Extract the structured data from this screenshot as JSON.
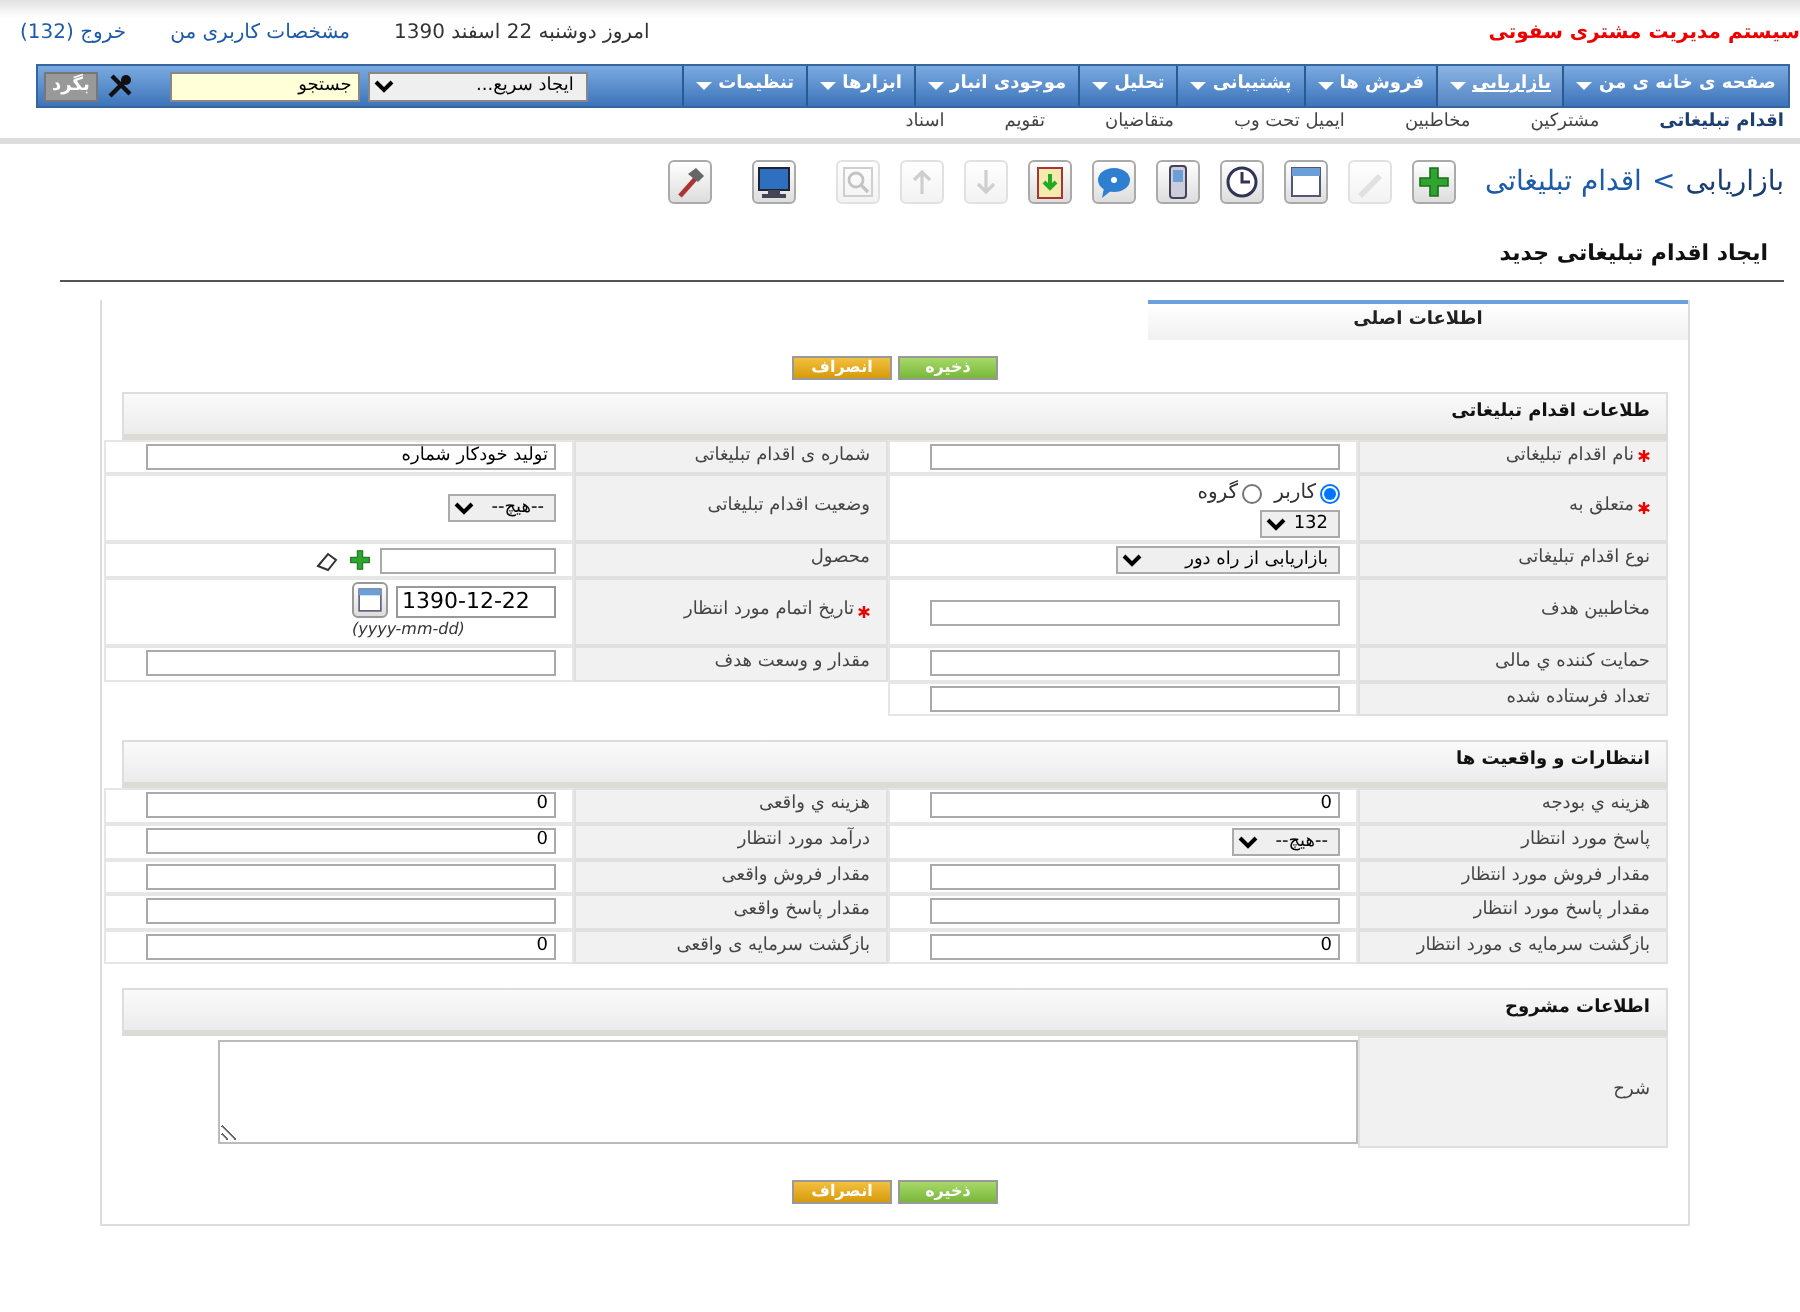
{
  "header": {
    "title": "سیستم مدیریت مشتری سفوتی",
    "date": "امروز دوشنبه 22 اسفند 1390",
    "links": [
      "مشخصات کاربری من",
      "خروج (132)"
    ]
  },
  "menu": [
    {
      "label": "صفحه ی خانه ی من",
      "selected": false
    },
    {
      "label": "بازاریابی",
      "selected": true
    },
    {
      "label": "فروش ها",
      "selected": false
    },
    {
      "label": "پشتیبانی",
      "selected": false
    },
    {
      "label": "تحلیل",
      "selected": false
    },
    {
      "label": "موجودی انبار",
      "selected": false
    },
    {
      "label": "ابزارها",
      "selected": false
    },
    {
      "label": "تنظیمات",
      "selected": false
    }
  ],
  "quick_create": {
    "value": "ایجاد سریع..."
  },
  "search": {
    "value": "جستجو",
    "button": "بگرد"
  },
  "submenu": [
    {
      "label": "اقدام تبلیغاتی",
      "selected": true
    },
    {
      "label": "مشترکین",
      "selected": false
    },
    {
      "label": "مخاطبین",
      "selected": false
    },
    {
      "label": "ایمیل تحت وب",
      "selected": false
    },
    {
      "label": "متقاضیان",
      "selected": false
    },
    {
      "label": "تقویم",
      "selected": false
    },
    {
      "label": "اسناد",
      "selected": false
    }
  ],
  "breadcrumb": [
    "بازاریابی",
    ">",
    "اقدام تبلیغاتی"
  ],
  "toolbar": [
    [
      {
        "kind": "add",
        "disabled": false
      },
      {
        "kind": "edit",
        "disabled": true
      },
      {
        "kind": "calendar",
        "disabled": false
      },
      {
        "kind": "clock",
        "disabled": false
      },
      {
        "kind": "mobile",
        "disabled": false
      },
      {
        "kind": "chat",
        "disabled": false
      },
      {
        "kind": "import",
        "disabled": false
      },
      {
        "kind": "down",
        "disabled": true
      },
      {
        "kind": "up",
        "disabled": true
      },
      {
        "kind": "find",
        "disabled": true
      }
    ],
    [
      {
        "kind": "monitor",
        "disabled": false
      }
    ],
    [
      {
        "kind": "hammer",
        "disabled": false
      }
    ]
  ],
  "page_title": "ایجاد اقدام تبلیغاتی جدید",
  "tabs": [
    {
      "label": "اطلاعات اصلی",
      "selected": true
    }
  ],
  "buttons": [
    {
      "kind": "save",
      "label": "ذخیره"
    },
    {
      "kind": "cancel",
      "label": "انصراف"
    }
  ],
  "sections": [
    {
      "title": "طلاعات اقدام تبلیغاتی",
      "rows": [
        [
          {
            "label": "نام اقدام تبلیغاتی",
            "required": true,
            "kind": "text"
          },
          {
            "label": "شماره ی اقدام تبلیغاتی",
            "required": false,
            "kind": "text",
            "value": "تولید خودکار شماره"
          }
        ],
        [
          {
            "label": "متعلق به",
            "required": true,
            "kind": "assign",
            "options": [
              {
                "label": "کاربر",
                "selected": true
              },
              {
                "label": "گروه",
                "selected": false
              }
            ],
            "value": "132"
          },
          {
            "label": "وضعیت اقدام تبلیغاتی",
            "required": false,
            "kind": "select",
            "value": "--هیچ--"
          }
        ],
        [
          {
            "label": "نوع اقدام تبلیغاتی",
            "required": false,
            "kind": "select",
            "value": "بازاریابی از راه دور"
          },
          {
            "label": "محصول",
            "required": false,
            "kind": "product"
          }
        ],
        [
          {
            "label": "مخاطبین هدف",
            "required": false,
            "kind": "text"
          },
          {
            "label": "تاریخ اتمام مورد انتظار",
            "required": true,
            "kind": "date",
            "value": "1390-12-22",
            "hint": "(yyyy-mm-dd)"
          }
        ],
        [
          {
            "label": "حمایت کننده ي مالی",
            "required": false,
            "kind": "text"
          },
          {
            "label": "مقدار و وسعت هدف",
            "required": false,
            "kind": "text"
          }
        ],
        [
          {
            "label": "تعداد فرستاده شده",
            "required": false,
            "kind": "text"
          }
        ]
      ]
    },
    {
      "title": "انتظارات و واقعیت ها",
      "rows": [
        [
          {
            "label": "هزینه ي بودجه",
            "required": false,
            "kind": "number",
            "value": "0"
          },
          {
            "label": "هزینه ي واقعی",
            "required": false,
            "kind": "number",
            "value": "0"
          }
        ],
        [
          {
            "label": "پاسخ مورد انتظار",
            "required": false,
            "kind": "select",
            "value": "--هیچ--"
          },
          {
            "label": "درآمد مورد انتظار",
            "required": false,
            "kind": "number",
            "value": "0"
          }
        ],
        [
          {
            "label": "مقدار فروش مورد انتظار",
            "required": false,
            "kind": "text"
          },
          {
            "label": "مقدار فروش واقعی",
            "required": false,
            "kind": "text"
          }
        ],
        [
          {
            "label": "مقدار پاسخ مورد انتظار",
            "required": false,
            "kind": "text"
          },
          {
            "label": "مقدار پاسخ واقعی",
            "required": false,
            "kind": "text"
          }
        ],
        [
          {
            "label": "بازگشت سرمایه ی مورد انتظار",
            "required": false,
            "kind": "number",
            "value": "0"
          },
          {
            "label": "بازگشت سرمایه ی واقعی",
            "required": false,
            "kind": "number",
            "value": "0"
          }
        ]
      ]
    },
    {
      "title": "اطلاعات مشروح",
      "rows": [
        [
          {
            "label": "شرح",
            "required": false,
            "kind": "textarea"
          }
        ]
      ]
    }
  ],
  "bottom_buttons": [
    {
      "kind": "save",
      "label": "ذخیره"
    },
    {
      "kind": "cancel",
      "label": "انصراف"
    }
  ]
}
